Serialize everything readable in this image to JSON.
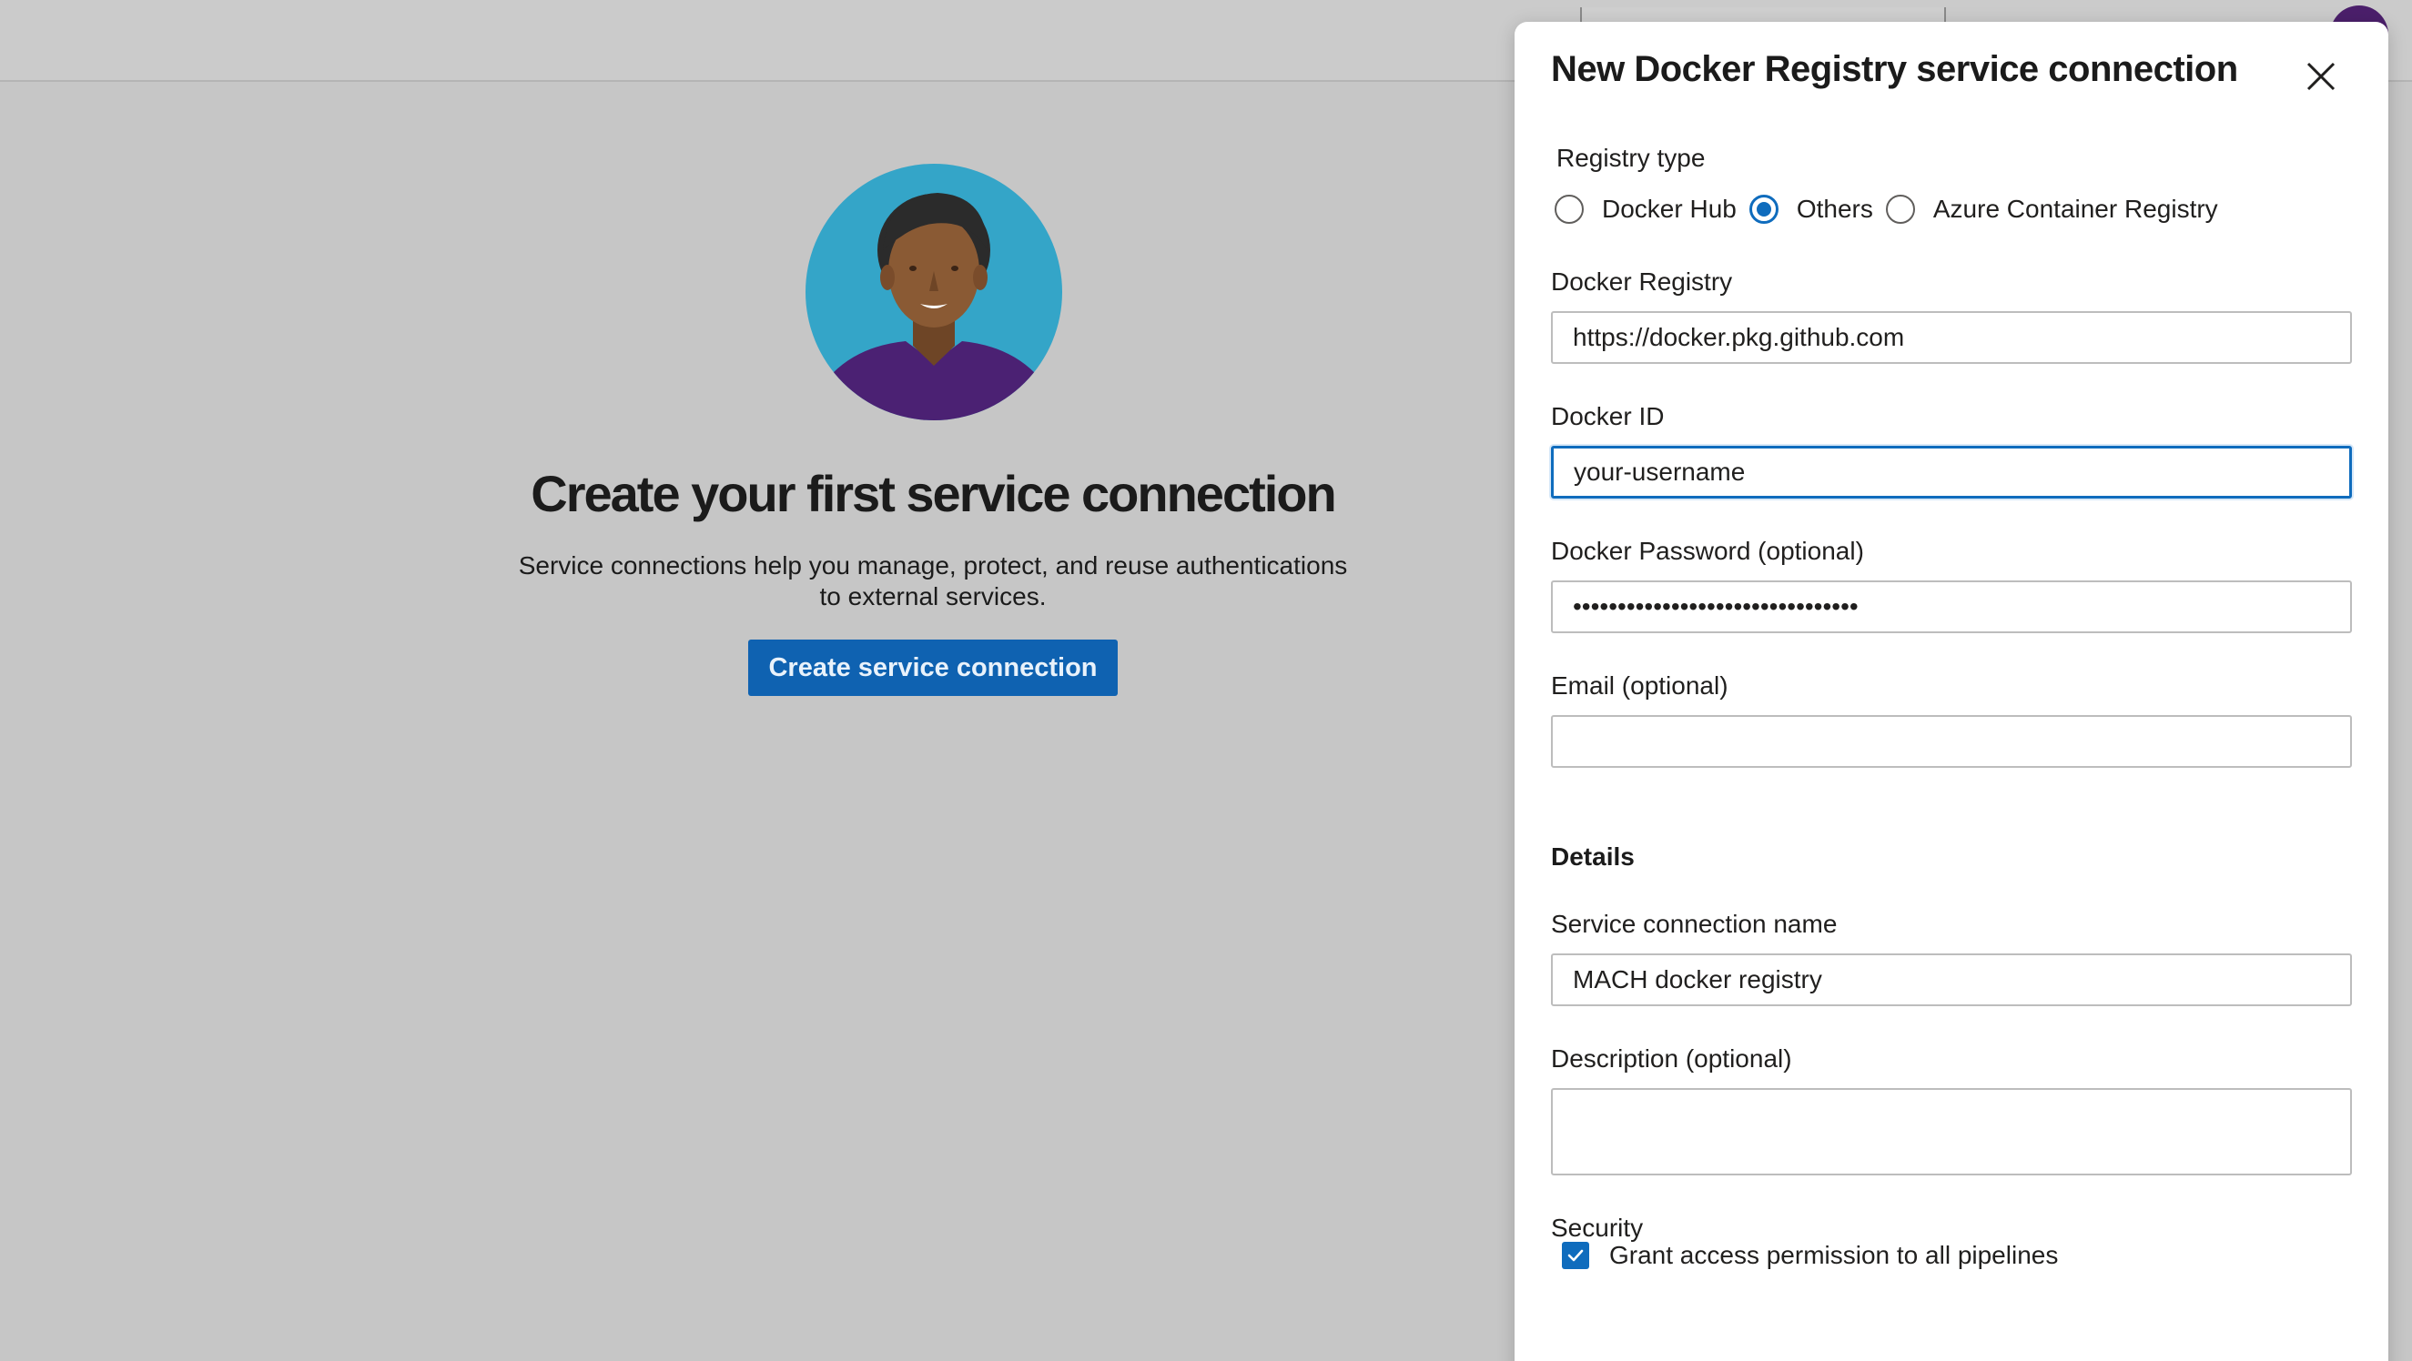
{
  "empty_state": {
    "title": "Create your first service connection",
    "description_line1": "Service connections help you manage, protect, and reuse authentications",
    "description_line2": "to external services.",
    "create_button_label": "Create service connection"
  },
  "panel": {
    "title": "New Docker Registry service connection",
    "registry_type": {
      "label": "Registry type",
      "options": [
        {
          "label": "Docker Hub",
          "checked": false
        },
        {
          "label": "Others",
          "checked": true
        },
        {
          "label": "Azure Container Registry",
          "checked": false
        }
      ]
    },
    "docker_registry": {
      "label": "Docker Registry",
      "value": "https://docker.pkg.github.com"
    },
    "docker_id": {
      "label": "Docker ID",
      "value": "your-username"
    },
    "docker_password": {
      "label": "Docker Password (optional)",
      "value": "••••••••••••••••••••••••••••••••"
    },
    "email": {
      "label": "Email (optional)",
      "value": ""
    },
    "details_heading": "Details",
    "service_connection_name": {
      "label": "Service connection name",
      "value": "MACH docker registry"
    },
    "description": {
      "label": "Description (optional)",
      "value": ""
    },
    "security": {
      "label": "Security",
      "grant_access_label": "Grant access permission to all pipelines",
      "grant_access_checked": true
    }
  },
  "colors": {
    "accent": "#0f6cbd",
    "primary_button": "#0f62b1",
    "overlay_background": "#c6c6c6",
    "illustration_circle": "#34a5c8",
    "shirt": "#4b2173",
    "skin": "#8a5a34",
    "hair": "#2b2b2b"
  },
  "icons": {
    "close": "close-icon",
    "check": "check-icon"
  }
}
